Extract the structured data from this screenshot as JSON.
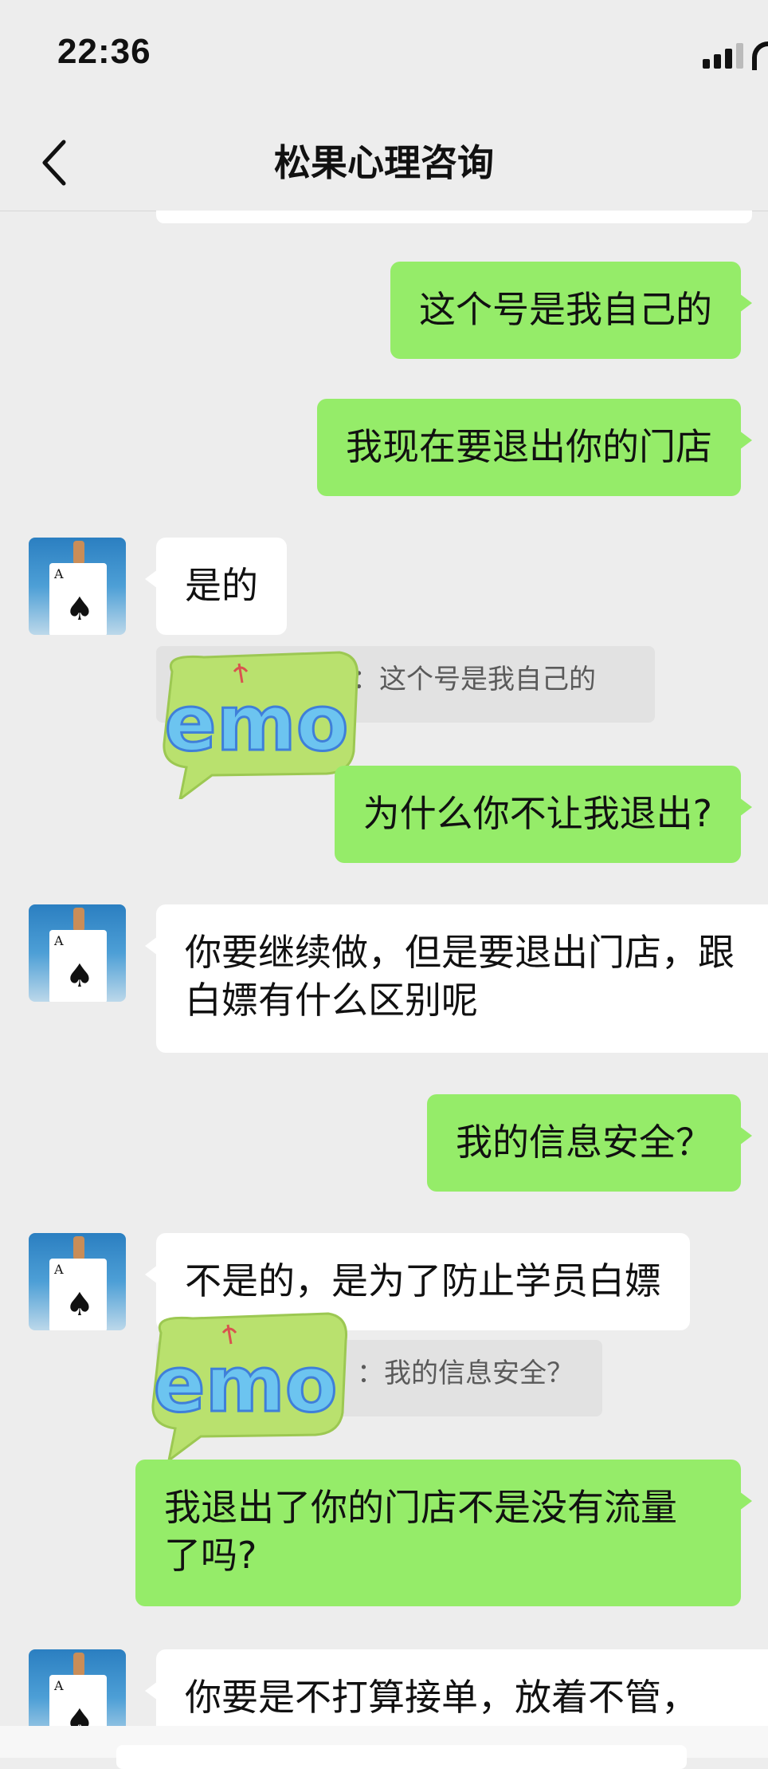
{
  "status_bar": {
    "time": "22:36"
  },
  "header": {
    "title": "松果心理咨询"
  },
  "messages": [
    {
      "text": "这个号是我自己的"
    },
    {
      "text": "我现在要退出你的门店"
    },
    {
      "text": "是的"
    },
    {
      "quote": "：这个号是我自己的"
    },
    {
      "text": "为什么你不让我退出?"
    },
    {
      "text": "你要继续做，但是要退出门店，跟白嫖有什么区别呢"
    },
    {
      "text": "我的信息安全？"
    },
    {
      "text": "不是的，是为了防止学员白嫖"
    },
    {
      "quote": "：我的信息安全？"
    },
    {
      "text": "我退出了你的门店不是没有流量了吗?"
    },
    {
      "text": "你要是不打算接单，放着不管，"
    }
  ],
  "sticker": {
    "text": "emo"
  },
  "avatar": {
    "card_rank": "A",
    "card_suit": "♠"
  },
  "colors": {
    "outgoing": "#95ec69",
    "incoming": "#ffffff",
    "background": "#ededed",
    "quote_bg": "#e2e2e2"
  }
}
